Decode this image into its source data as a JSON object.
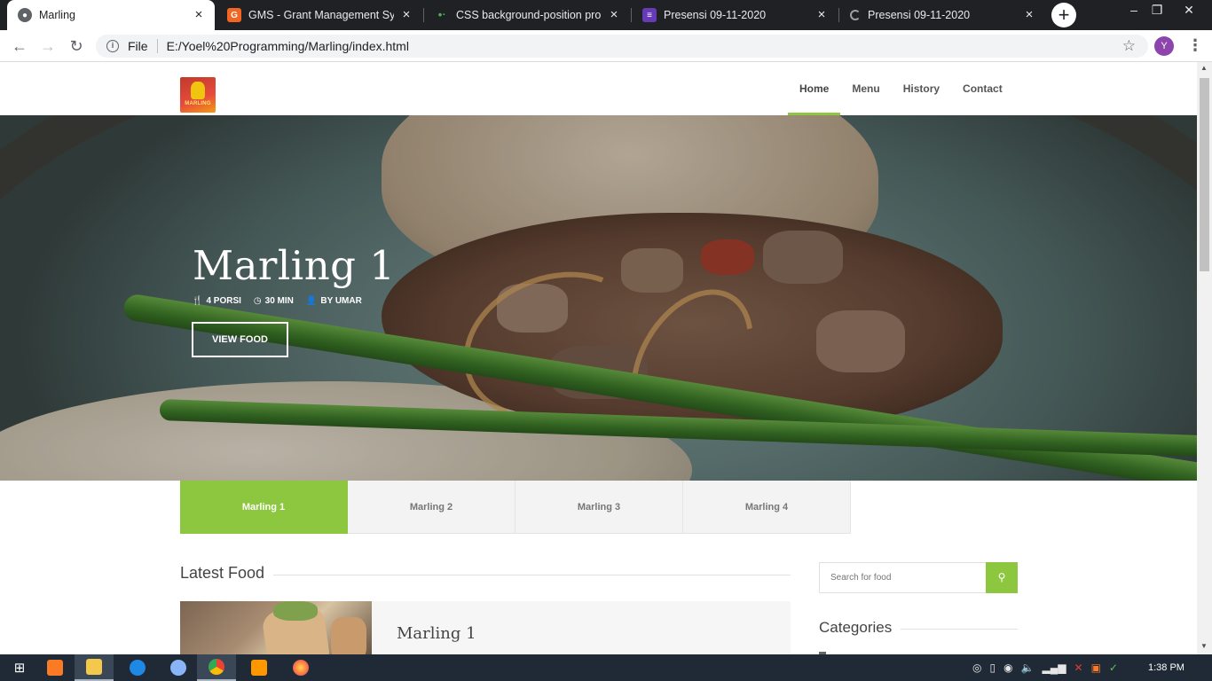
{
  "browser": {
    "tabs": [
      {
        "title": "Marling",
        "active": true,
        "favicon": "globe-icon"
      },
      {
        "title": "GMS - Grant Management Sysyem",
        "active": false,
        "favicon": "gms-icon"
      },
      {
        "title": "CSS background-position property",
        "active": false,
        "favicon": "w3schools-icon"
      },
      {
        "title": "Presensi 09-11-2020",
        "active": false,
        "favicon": "forms-icon"
      },
      {
        "title": "Presensi 09-11-2020",
        "active": false,
        "favicon": "loading-icon"
      }
    ],
    "address": {
      "protocol": "File",
      "url": "E:/Yoel%20Programming/Marling/index.html"
    },
    "profile_initial": "Y"
  },
  "site": {
    "logo_text": "MARLING",
    "nav": [
      {
        "label": "Home",
        "active": true
      },
      {
        "label": "Menu",
        "active": false
      },
      {
        "label": "History",
        "active": false
      },
      {
        "label": "Contact",
        "active": false
      }
    ],
    "hero": {
      "title": "Marling 1",
      "meta": [
        {
          "icon": "utensils-icon",
          "text": "4 PORSI"
        },
        {
          "icon": "clock-icon",
          "text": "30 MIN"
        },
        {
          "icon": "user-icon",
          "text": "BY UMAR"
        }
      ],
      "button": "VIEW FOOD"
    },
    "recipe_tabs": [
      {
        "label": "Marling 1",
        "active": true
      },
      {
        "label": "Marling 2",
        "active": false
      },
      {
        "label": "Marling 3",
        "active": false
      },
      {
        "label": "Marling 4",
        "active": false
      }
    ],
    "latest": {
      "heading": "Latest Food",
      "items": [
        {
          "title": "Marling 1"
        }
      ]
    },
    "sidebar": {
      "search_placeholder": "Search for food",
      "categories_heading": "Categories"
    },
    "accent_color": "#8dc63f"
  },
  "taskbar": {
    "clock": "1:38 PM"
  }
}
